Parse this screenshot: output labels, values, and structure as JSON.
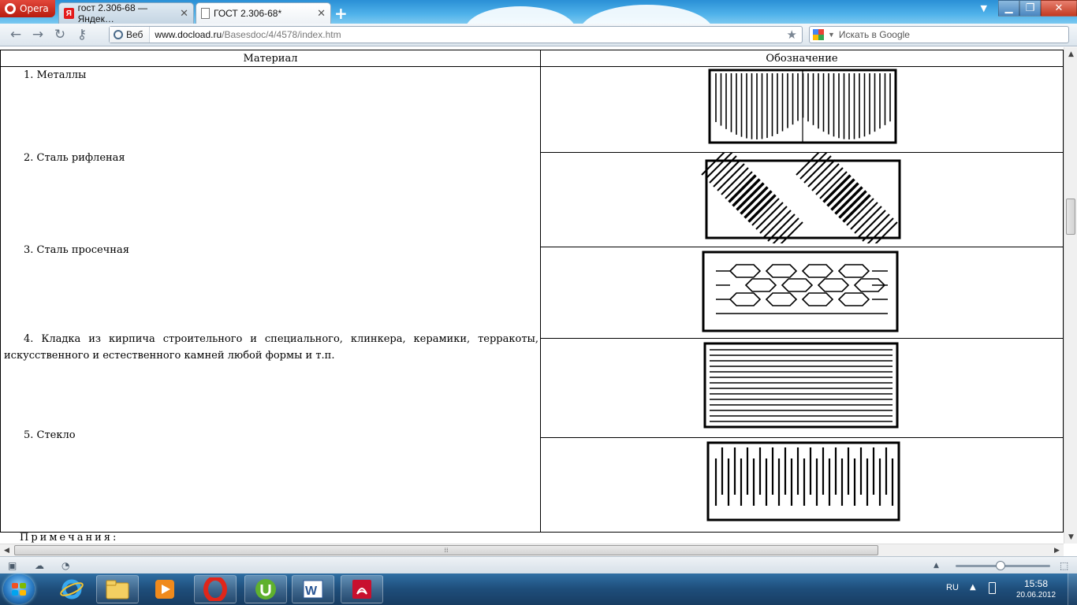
{
  "browser": {
    "menu_label": "Opera",
    "tabs": [
      {
        "label": "гост 2.306-68 — Яндек…",
        "favicon": "Я"
      },
      {
        "label": "ГОСТ 2.306-68*"
      }
    ],
    "new_tab": "+",
    "window_controls": {
      "minimize": "▁",
      "maximize": "❐",
      "close": "✕"
    },
    "address": {
      "badge": "Веб",
      "domain": "www.docload.ru",
      "path": "/Basesdoc/4/4578/index.htm"
    },
    "search_placeholder": "Искать в Google",
    "accent_color": "#2a8fd6"
  },
  "document": {
    "headers": {
      "material": "Материал",
      "symbol": "Обозначение"
    },
    "rows": [
      {
        "material": "1.  Металлы",
        "pattern": "metal-hatch-icon"
      },
      {
        "material": "2.  Сталь рифленая",
        "pattern": "corrugated-steel-icon"
      },
      {
        "material": "3.  Сталь просечная",
        "pattern": "expanded-steel-icon"
      },
      {
        "material": "4.  Кладка из кирпича строительного и специального, клинкера, керамики, терракоты, искусственного и естественного камней любой формы и т.п.",
        "pattern": "brick-masonry-icon"
      },
      {
        "material": "5.  Стекло",
        "pattern": "glass-hatch-icon"
      }
    ],
    "notes_heading": "Примечания:"
  },
  "taskbar": {
    "language": "RU",
    "time": "15:58",
    "date": "20.06.2012",
    "apps": [
      "internet-explorer-icon",
      "explorer-icon",
      "media-player-icon",
      "opera-icon",
      "utorrent-icon",
      "word-icon",
      "acrobat-icon"
    ]
  }
}
